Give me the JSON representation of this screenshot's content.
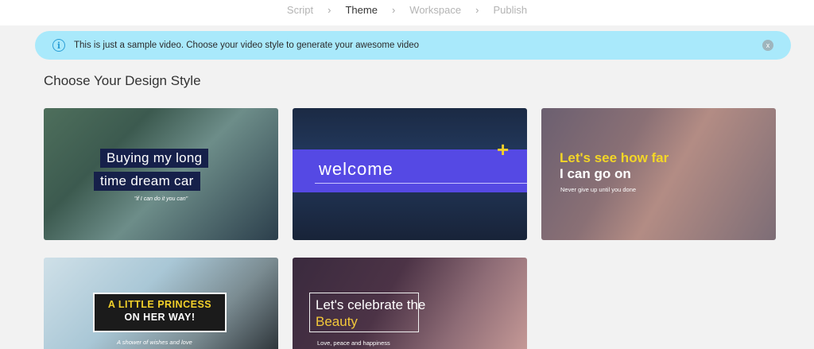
{
  "stepper": {
    "steps": [
      "Script",
      "Theme",
      "Workspace",
      "Publish"
    ],
    "active": "Theme"
  },
  "banner": {
    "icon": "info-icon",
    "text": "This is just a sample video. Choose your video style to generate your awesome video",
    "close_label": "x"
  },
  "main": {
    "heading": "Choose Your Design Style",
    "cards": [
      {
        "line1": "Buying my long",
        "line2": "time dream car",
        "sub": "\"if I can do it you can\""
      },
      {
        "title": "welcome",
        "accent": "+"
      },
      {
        "line1": "Let's see how far",
        "line2": "I can go on",
        "sub": "Never give up until you done"
      },
      {
        "line1": "A LITTLE PRINCESS",
        "line2": "ON HER WAY!",
        "sub": "A shower of wishes and love"
      },
      {
        "line1": "Let's celebrate the",
        "line2": "Beauty",
        "sub": "Love, peace and happiness"
      }
    ]
  },
  "colors": {
    "banner_bg": "#a9e9fb",
    "info_accent": "#2a9ed6",
    "page_bg": "#f2f2f2",
    "welcome_band": "#5a4bf0",
    "highlight_yellow": "#f3d627"
  }
}
